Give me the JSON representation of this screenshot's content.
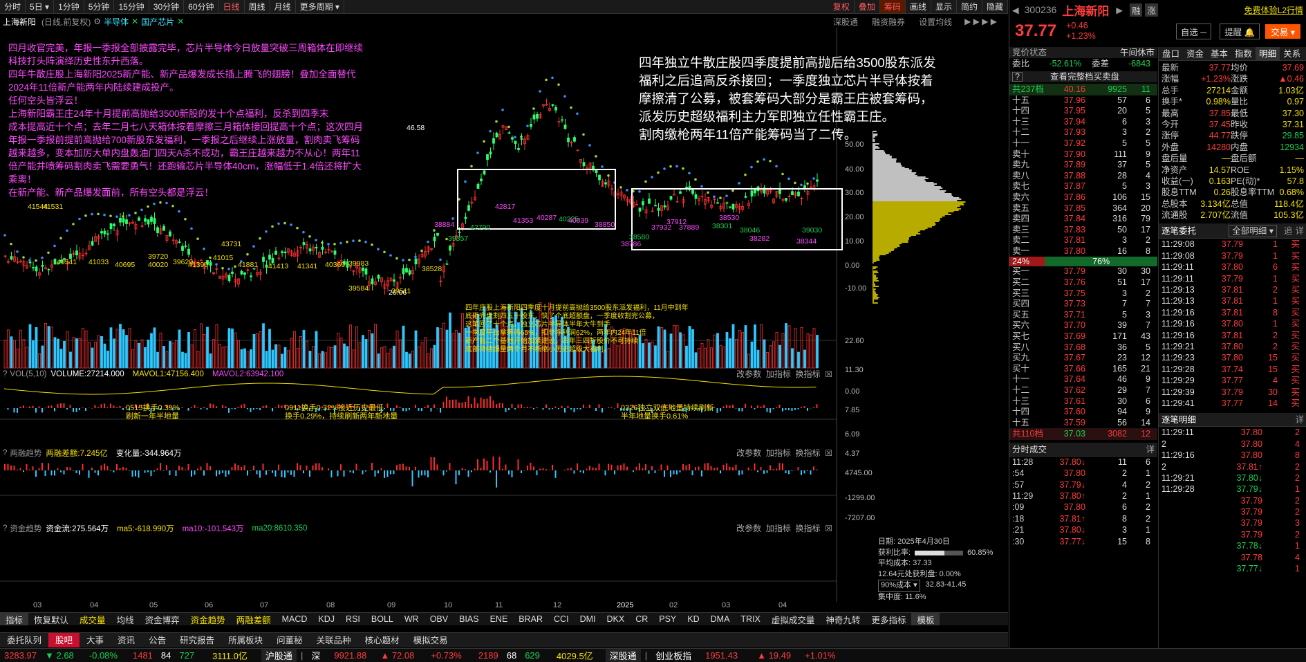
{
  "topbar": {
    "items": [
      "分时",
      "5日",
      "1分钟",
      "5分钟",
      "15分钟",
      "30分钟",
      "60分钟",
      "日线",
      "周线",
      "月线",
      "更多周期"
    ],
    "active": "日线",
    "right": [
      "复权",
      "叠加",
      "筹码",
      "画线",
      "显示",
      "简约",
      "隐藏"
    ]
  },
  "title": {
    "stock": "上海新阳",
    "mode": "(日线,前复权)",
    "tags": [
      "半导体",
      "国产芯片"
    ],
    "right": [
      "深股通",
      "融资融券",
      "设置均线"
    ]
  },
  "annotations": {
    "left": [
      "四月收官完美，年报一季报全部披露完毕，芯片半导体今日放量突破三周箱体在即继续",
      "科技打头阵演绎历史性东升西落。",
      "四年牛散庄股上海新阳2025新产能、新产品爆发成长插上腾飞的翅膀！叠加全面替代",
      "2024年11倍新产能两年内陆续建成投产。",
      "任何空头皆浮云！",
      "上海新阳霸王庄24年十月提前高抛给3500新股的发十个点福利，反杀到四季末",
      "成本提高近十个点；去年二月七八天箱体按着摩擦三月箱体接回提高十个点；这次四月",
      "年报一季报前提前高抛给700新股东发福利，一季报之后继续上涨放量，割肉卖飞筹码",
      "越来越多，变本加厉大单内盘轰油门四天A杀不成功，霸王庄越来越力不从心！两年11",
      "倍产能井喷筹码割肉卖飞需要勇气！还跑输芯片半导体40cm，涨幅低于1.4倍还将扩大",
      "乘离！",
      "在新产能、新产品爆发面前，所有空头都是浮云！"
    ],
    "right": [
      "四年独立牛散庄股四季度提前高抛后给3500股东派发",
      "福利之后追高反杀接回；一季度独立芯片半导体按着",
      "摩擦清了公募，被套筹码大部分是霸王庄被套筹码，",
      "派发历史超级福利主力军即独立任性霸王庄。",
      "割肉缴枪两年11倍产能筹码当了二传。"
    ],
    "middle": [
      "四年庄股上海新阳四季度十月提前高抛给3500股东派发福利，11月中到年",
      "底砸完盘割四五十股东，筑了个底超额盘，一季度收割完公募，",
      "这笔回了十个点，独立芯片半导体半年大牛到手",
      "一季度平台拿筹码65%，扣非净利润62%，两年内24年11倍",
      "新产能二个基地开始加紧建设，四年三四折股价不可持续！",
      "底部持续爆量两个月不断缩小历史超级大福利。"
    ],
    "vol1": [
      "0515换手0.39%",
      "刷新一年半地量"
    ],
    "vol2": [
      "0911换手0.32%接近历史最低",
      "换手0.29%，持续刷新两年新地量"
    ],
    "vol3": [
      "0326独立双底地量持续刷新",
      "半年地量换手0.61%"
    ]
  },
  "price_labels": [
    "46.58",
    "26.06",
    "42817",
    "42790",
    "41353",
    "40287",
    "40225",
    "40039",
    "38850",
    "39357",
    "38884",
    "38786",
    "38580",
    "37932",
    "37889",
    "38301",
    "38530",
    "37912",
    "38046",
    "38282",
    "38344",
    "39030",
    "41541",
    "41033",
    "40695",
    "40020",
    "39720",
    "39620",
    "41390",
    "41015",
    "43731",
    "41881",
    "41413",
    "41341",
    "40369",
    "39983",
    "39584",
    "39511",
    "38528",
    "41544",
    "41531"
  ],
  "yaxis_main": [
    "50.00",
    "40.00",
    "30.00",
    "20.00",
    "10.00",
    "0.00",
    "-10.00"
  ],
  "sub1": {
    "title": "VOL(5,10)",
    "vol": "VOLUME:27214.000",
    "ma1": "MAVOL1:47156.400",
    "ma2": "MAVOL2:63942.100",
    "y": [
      "22.60",
      "11.30",
      "0.00"
    ]
  },
  "sub2": {
    "title": "两融趋势",
    "a": "两融差额:7.245亿",
    "b": "变化量:-344.964万",
    "y": [
      "7.85",
      "6.09",
      "4.37"
    ]
  },
  "sub3": {
    "title": "资金趋势",
    "a": "资金流:275.564万",
    "b": "ma5:-618.990万",
    "c": "ma10:-101.543万",
    "d": "ma20:8610.350",
    "y": [
      "4745.00",
      "-1299.00",
      "-7207.00"
    ]
  },
  "subctl": [
    "改参数",
    "加指标",
    "换指标"
  ],
  "chip": {
    "date": "日期: 2025年4月30日",
    "profit_label": "获利比率:",
    "profit": "60.85%",
    "avg_label": "平均成本:",
    "avg": "37.33",
    "line3": "12.64元处获利盘: 0.00%",
    "cost_sel": "90%成本",
    "cost_range": "32.83-41.45",
    "conc": "集中度: 11.6%"
  },
  "xaxis": [
    "03",
    "04",
    "05",
    "06",
    "07",
    "08",
    "09",
    "10",
    "11",
    "12",
    "2025",
    "02",
    "03",
    "04"
  ],
  "indbar": [
    "指标",
    "恢复默认",
    "成交量",
    "均线",
    "资金博弈",
    "资金趋势",
    "两融差额",
    "MACD",
    "KDJ",
    "RSI",
    "BOLL",
    "WR",
    "OBV",
    "BIAS",
    "ENE",
    "BRAR",
    "CCI",
    "DMI",
    "DKX",
    "CR",
    "PSY",
    "KD",
    "DMA",
    "TRIX",
    "虚拟成交量",
    "神奇九转",
    "更多指标",
    "模板"
  ],
  "tabbar": [
    "委托队列",
    "股吧",
    "大事",
    "资讯",
    "公告",
    "研究报告",
    "所属板块",
    "问董秘",
    "关联品种",
    "核心题材",
    "模拟交易"
  ],
  "status": {
    "sh": "3283.97",
    "sh_ch": "▼ 2.68",
    "sh_pct": "-0.08%",
    "sh_n": "1481",
    "sh_m": "84",
    "sh_d": "727",
    "sh_amt": "3111.0亿",
    "hgt": "沪股通",
    "sz_lab": "深",
    "sz": "9921.88",
    "sz_ch": "▲ 72.08",
    "sz_pct": "+0.73%",
    "sz_n": "2189",
    "sz_m": "68",
    "sz_d": "629",
    "sz_amt": "4029.5亿",
    "sgt": "深股通",
    "cy_lab": "创业板指",
    "cy": "1951.43",
    "cy_ch": "▲ 19.49",
    "cy_pct": "+1.01%"
  },
  "quote": {
    "code": "300236",
    "name": "上海新阳",
    "tags": [
      "融",
      "涨"
    ],
    "free": "免费体验L2行情",
    "price": "37.77",
    "chg": "+0.46",
    "pct": "+1.23%",
    "btns": [
      "自选",
      "提醒",
      "交易"
    ],
    "wb_label": "委比",
    "wb": "-52.61%",
    "wc_label": "委差",
    "wc": "-6843",
    "state_l": "竞价状态",
    "state_r": "午间休市",
    "full": "查看完整档买卖盘",
    "sell_total": {
      "label": "共237档",
      "price": "40.16",
      "vol": "9925",
      "n": "11"
    },
    "sells": [
      [
        "十五",
        "37.96",
        "57",
        "6"
      ],
      [
        "十四",
        "37.95",
        "20",
        "5"
      ],
      [
        "十三",
        "37.94",
        "6",
        "3"
      ],
      [
        "十二",
        "37.93",
        "3",
        "2"
      ],
      [
        "十一",
        "37.92",
        "5",
        "5"
      ],
      [
        "卖十",
        "37.90",
        "111",
        "9"
      ],
      [
        "卖九",
        "37.89",
        "37",
        "5"
      ],
      [
        "卖八",
        "37.88",
        "28",
        "4"
      ],
      [
        "卖七",
        "37.87",
        "5",
        "3"
      ],
      [
        "卖六",
        "37.86",
        "106",
        "15"
      ],
      [
        "卖五",
        "37.85",
        "364",
        "20"
      ],
      [
        "卖四",
        "37.84",
        "316",
        "79"
      ],
      [
        "卖三",
        "37.83",
        "50",
        "17"
      ],
      [
        "卖二",
        "37.81",
        "3",
        "2"
      ],
      [
        "卖一",
        "37.80",
        "16",
        "8"
      ]
    ],
    "ratio": [
      "24%",
      "76%"
    ],
    "buys": [
      [
        "买一",
        "37.79",
        "30",
        "30"
      ],
      [
        "买二",
        "37.76",
        "51",
        "17"
      ],
      [
        "买三",
        "37.75",
        "3",
        "2"
      ],
      [
        "买四",
        "37.73",
        "7",
        "7"
      ],
      [
        "买五",
        "37.71",
        "5",
        "3"
      ],
      [
        "买六",
        "37.70",
        "39",
        "7"
      ],
      [
        "买七",
        "37.69",
        "171",
        "43"
      ],
      [
        "买八",
        "37.68",
        "36",
        "5"
      ],
      [
        "买九",
        "37.67",
        "23",
        "12"
      ],
      [
        "买十",
        "37.66",
        "165",
        "21"
      ],
      [
        "十一",
        "37.64",
        "46",
        "9"
      ],
      [
        "十二",
        "37.62",
        "29",
        "7"
      ],
      [
        "十三",
        "37.61",
        "30",
        "6"
      ],
      [
        "十四",
        "37.60",
        "94",
        "9"
      ],
      [
        "十五",
        "37.59",
        "56",
        "14"
      ]
    ],
    "buy_total": {
      "label": "共110档",
      "price": "37.03",
      "vol": "3082",
      "n": "12"
    },
    "fs_title": "分时成交",
    "fs": [
      [
        "11:28",
        "37.80↓",
        "11",
        "6"
      ],
      [
        ":54",
        "37.80",
        "2",
        "1"
      ],
      [
        ":57",
        "37.79↓",
        "4",
        "2"
      ],
      [
        "11:29",
        "37.80↑",
        "2",
        "1"
      ],
      [
        ":09",
        "37.80",
        "6",
        "2"
      ],
      [
        ":18",
        "37.81↑",
        "8",
        "2"
      ],
      [
        ":21",
        "37.80↓",
        "3",
        "1"
      ],
      [
        ":30",
        "37.77↓",
        "15",
        "8"
      ]
    ]
  },
  "rtabs": [
    "盘口",
    "资金",
    "基本",
    "指数",
    "明细",
    "关系"
  ],
  "stats": [
    [
      "最新",
      "37.77",
      "均价",
      "37.69"
    ],
    [
      "涨幅",
      "+1.23%",
      "涨跌",
      "▲0.46"
    ],
    [
      "总手",
      "27214",
      "金额",
      "1.03亿"
    ],
    [
      "换手*",
      "0.98%",
      "量比",
      "0.97"
    ],
    [
      "最高",
      "37.85",
      "最低",
      "37.30"
    ],
    [
      "今开",
      "37.45",
      "昨收",
      "37.31"
    ],
    [
      "涨停",
      "44.77",
      "跌停",
      "29.85"
    ],
    [
      "外盘",
      "14280",
      "内盘",
      "12934"
    ],
    [
      "盘后量",
      "—",
      "盘后额",
      "—"
    ],
    [
      "净资产",
      "14.57",
      "ROE",
      "1.15%"
    ],
    [
      "收益(一)",
      "0.163",
      "PE(动)*",
      "57.8"
    ],
    [
      "股息TTM",
      "0.26",
      "股息率TTM",
      "0.68%"
    ],
    [
      "总股本",
      "3.134亿",
      "总值",
      "118.4亿"
    ],
    [
      "流通股",
      "2.707亿",
      "流值",
      "105.3亿"
    ]
  ],
  "zbwt": {
    "title": "逐笔委托",
    "sel": "全部明细",
    "r1": "追",
    "r2": "详",
    "rows": [
      [
        "11:29:08",
        "37.79",
        "1",
        "买"
      ],
      [
        "11:29:08",
        "37.79",
        "1",
        "买"
      ],
      [
        "11:29:11",
        "37.80",
        "6",
        "买"
      ],
      [
        "11:29:11",
        "37.79",
        "1",
        "买"
      ],
      [
        "11:29:13",
        "37.81",
        "2",
        "买"
      ],
      [
        "11:29:13",
        "37.81",
        "1",
        "买"
      ],
      [
        "11:29:16",
        "37.81",
        "8",
        "买"
      ],
      [
        "11:29:16",
        "37.80",
        "1",
        "买"
      ],
      [
        "11:29:16",
        "37.81",
        "2",
        "买"
      ],
      [
        "11:29:21",
        "37.80",
        "2",
        "买"
      ],
      [
        "11:29:23",
        "37.80",
        "15",
        "买"
      ],
      [
        "11:29:28",
        "37.74",
        "15",
        "买"
      ],
      [
        "11:29:29",
        "37.77",
        "4",
        "买"
      ],
      [
        "11:29:39",
        "37.79",
        "30",
        "买"
      ],
      [
        "11:29:41",
        "37.77",
        "14",
        "买"
      ]
    ]
  },
  "zbmx": {
    "title": "逐笔明细",
    "r": "详",
    "rows": [
      [
        "11:29:11",
        "37.80",
        "2"
      ],
      [
        "2",
        "37.80",
        "4"
      ],
      [
        "11:29:16",
        "37.80",
        "8"
      ],
      [
        "2",
        "37.81↑",
        "2"
      ],
      [
        "11:29:21",
        "37.80↓",
        "2"
      ],
      [
        "11:29:28",
        "37.79↓",
        "1"
      ],
      [
        "",
        "37.79",
        "2"
      ],
      [
        "",
        "37.79",
        "2"
      ],
      [
        "",
        "37.79",
        "3"
      ],
      [
        "",
        "37.79",
        "2"
      ],
      [
        "",
        "37.78↓",
        "1"
      ],
      [
        "",
        "37.78",
        "4"
      ],
      [
        "",
        "37.77↓",
        "1"
      ]
    ]
  }
}
